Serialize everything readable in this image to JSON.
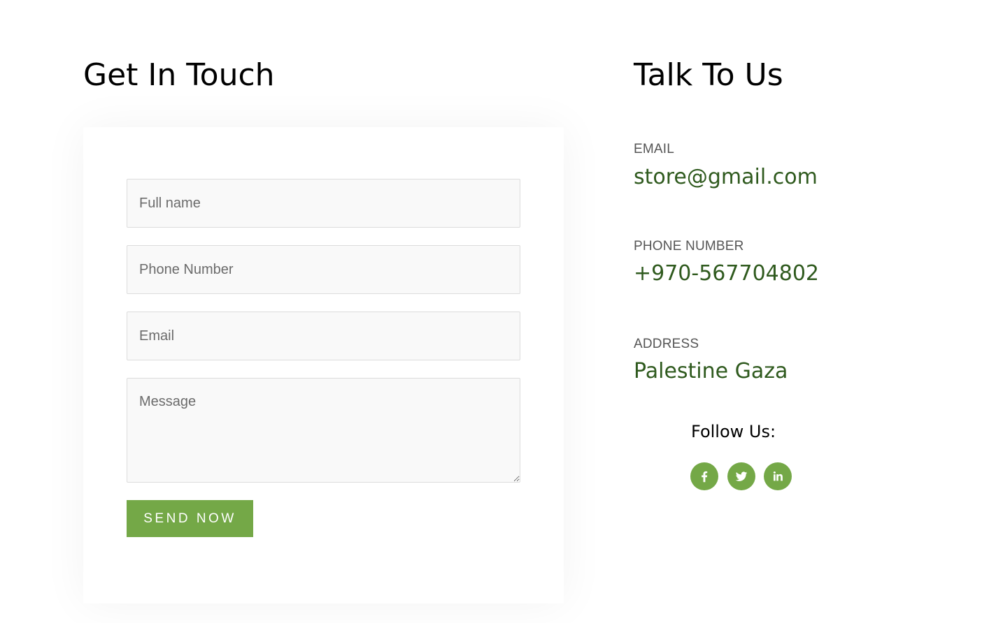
{
  "contact_form": {
    "heading": "Get In Touch",
    "full_name_placeholder": "Full name",
    "phone_placeholder": "Phone Number",
    "email_placeholder": "Email",
    "message_placeholder": "Message",
    "submit_label": "SEND NOW"
  },
  "talk_to_us": {
    "heading": "Talk To Us",
    "email_label": "EMAIL",
    "email_value": "store@gmail.com",
    "phone_label": "PHONE NUMBER",
    "phone_value": "+970-567704802",
    "address_label": "ADDRESS",
    "address_value": "Palestine Gaza"
  },
  "follow": {
    "label": "Follow Us:",
    "icons": [
      "facebook-icon",
      "twitter-icon",
      "linkedin-icon"
    ]
  },
  "colors": {
    "accent": "#74a847",
    "value_text": "#2f5a1e",
    "label_text": "#555555"
  }
}
